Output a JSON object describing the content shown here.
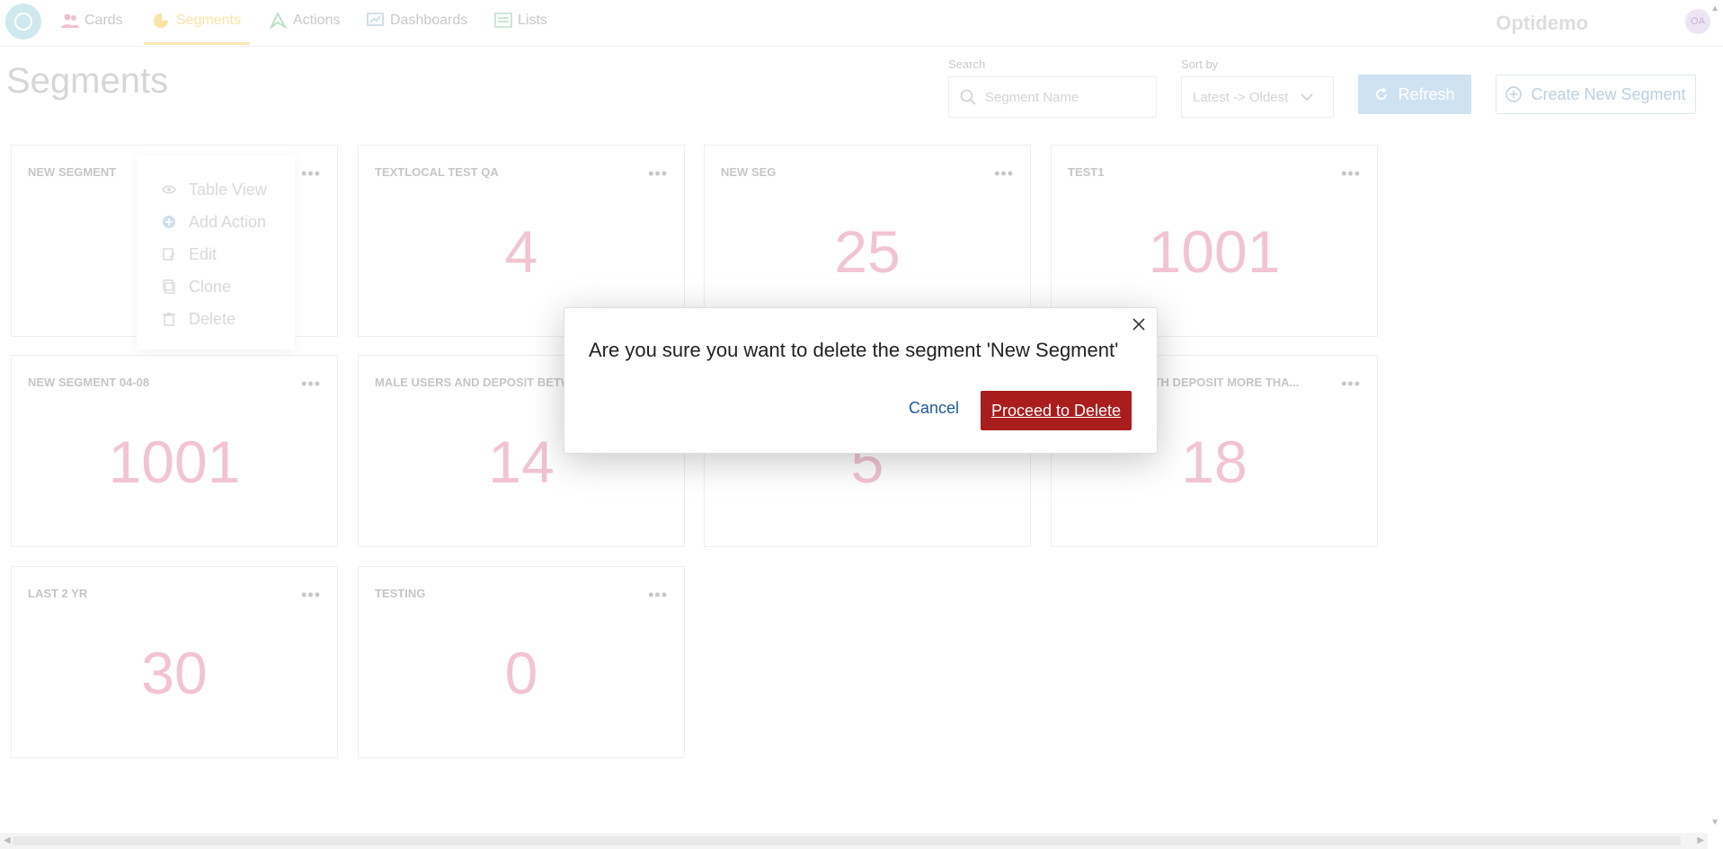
{
  "nav": {
    "tabs": [
      {
        "label": "Cards",
        "icon": "users-icon"
      },
      {
        "label": "Segments",
        "icon": "pie-chart-icon"
      },
      {
        "label": "Actions",
        "icon": "send-icon"
      },
      {
        "label": "Dashboards",
        "icon": "dashboard-icon"
      },
      {
        "label": "Lists",
        "icon": "list-icon"
      }
    ],
    "active_tab": "Segments",
    "brand": "Optidemo",
    "avatar_initials": "OA"
  },
  "header": {
    "title": "Segments",
    "search_label": "Search",
    "search_placeholder": "Segment Name",
    "sort_label": "Sort by",
    "sort_value": "Latest -> Oldest",
    "refresh_label": "Refresh",
    "create_label": "Create New Segment"
  },
  "segments": [
    {
      "name": "NEW SEGMENT",
      "count": ""
    },
    {
      "name": "TEXTLOCAL TEST QA",
      "count": "4"
    },
    {
      "name": "NEW SEG",
      "count": "25"
    },
    {
      "name": "TEST1",
      "count": "1001"
    },
    {
      "name": "NEW SEGMENT 04-08",
      "count": "1001"
    },
    {
      "name": "MALE USERS AND DEPOSIT BETW",
      "count": "14"
    },
    {
      "name": "",
      "count": "5"
    },
    {
      "name": "ITH DEPOSIT MORE THA...",
      "count": "18"
    },
    {
      "name": "LAST 2 YR",
      "count": "30"
    },
    {
      "name": "TESTING",
      "count": "0"
    }
  ],
  "card_menu": {
    "items": [
      {
        "label": "Table View",
        "icon": "eye-icon"
      },
      {
        "label": "Add Action",
        "icon": "plus-circle-icon"
      },
      {
        "label": "Edit",
        "icon": "edit-icon"
      },
      {
        "label": "Clone",
        "icon": "clone-icon"
      },
      {
        "label": "Delete",
        "icon": "trash-icon"
      }
    ]
  },
  "modal": {
    "message": "Are you sure you want to delete the segment 'New Segment'",
    "cancel_label": "Cancel",
    "confirm_label": "Proceed to Delete"
  },
  "colors": {
    "accent_active_tab": "#fbe3a3",
    "count_color": "#f2c4d2",
    "danger": "#a91d1d",
    "link": "#1d5b9b"
  }
}
